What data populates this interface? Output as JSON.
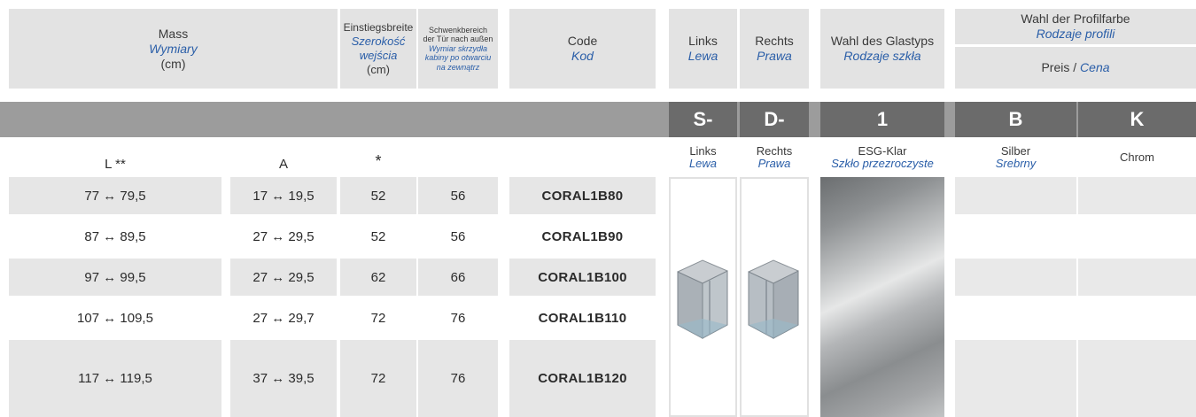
{
  "header": {
    "mass": {
      "de": "Mass",
      "pl": "Wymiary",
      "unit": "(cm)"
    },
    "einstieg": {
      "de": "Einstiegsbreite",
      "pl1": "Szerokość",
      "pl2": "wejścia",
      "unit": "(cm)"
    },
    "schwenk": {
      "de1": "Schwenkbereich",
      "de2": "der Tür nach außen",
      "pl1": "Wymiar skrzydła",
      "pl2": "kabiny po otwarciu",
      "pl3": "na zewnątrz"
    },
    "code": {
      "de": "Code",
      "pl": "Kod"
    },
    "links": {
      "de": "Links",
      "pl": "Lewa"
    },
    "rechts": {
      "de": "Rechts",
      "pl": "Prawa"
    },
    "glas": {
      "de": "Wahl des Glastyps",
      "pl": "Rodzaje szkła"
    },
    "profil": {
      "de": "Wahl der Profilfarbe",
      "pl": "Rodzaje profili"
    },
    "preis": {
      "de": "Preis / ",
      "pl": "Cena"
    }
  },
  "bar": {
    "s": "S-",
    "d": "D-",
    "glass": "1",
    "b": "B",
    "k": "K"
  },
  "options": {
    "links": {
      "de": "Links",
      "pl": "Lewa"
    },
    "rechts": {
      "de": "Rechts",
      "pl": "Prawa"
    },
    "glass": {
      "de": "ESG-Klar",
      "pl": "Szkło przezroczyste"
    },
    "silber": {
      "de": "Silber",
      "pl": "Srebrny"
    },
    "chrom": {
      "de": "Chrom"
    }
  },
  "columns": {
    "l": "L **",
    "a": "A",
    "star": "*"
  },
  "rows": [
    {
      "l": "77 ↔ 79,5",
      "a": "17 ↔ 19,5",
      "e": "52",
      "s": "56",
      "code": "CORAL1B80"
    },
    {
      "l": "87 ↔ 89,5",
      "a": "27 ↔ 29,5",
      "e": "52",
      "s": "56",
      "code": "CORAL1B90"
    },
    {
      "l": "97 ↔ 99,5",
      "a": "27 ↔ 29,5",
      "e": "62",
      "s": "66",
      "code": "CORAL1B100"
    },
    {
      "l": "107 ↔ 109,5",
      "a": "27 ↔ 29,7",
      "e": "72",
      "s": "76",
      "code": "CORAL1B110"
    },
    {
      "l": "117 ↔ 119,5",
      "a": "37 ↔ 39,5",
      "e": "72",
      "s": "76",
      "code": "CORAL1B120"
    }
  ]
}
